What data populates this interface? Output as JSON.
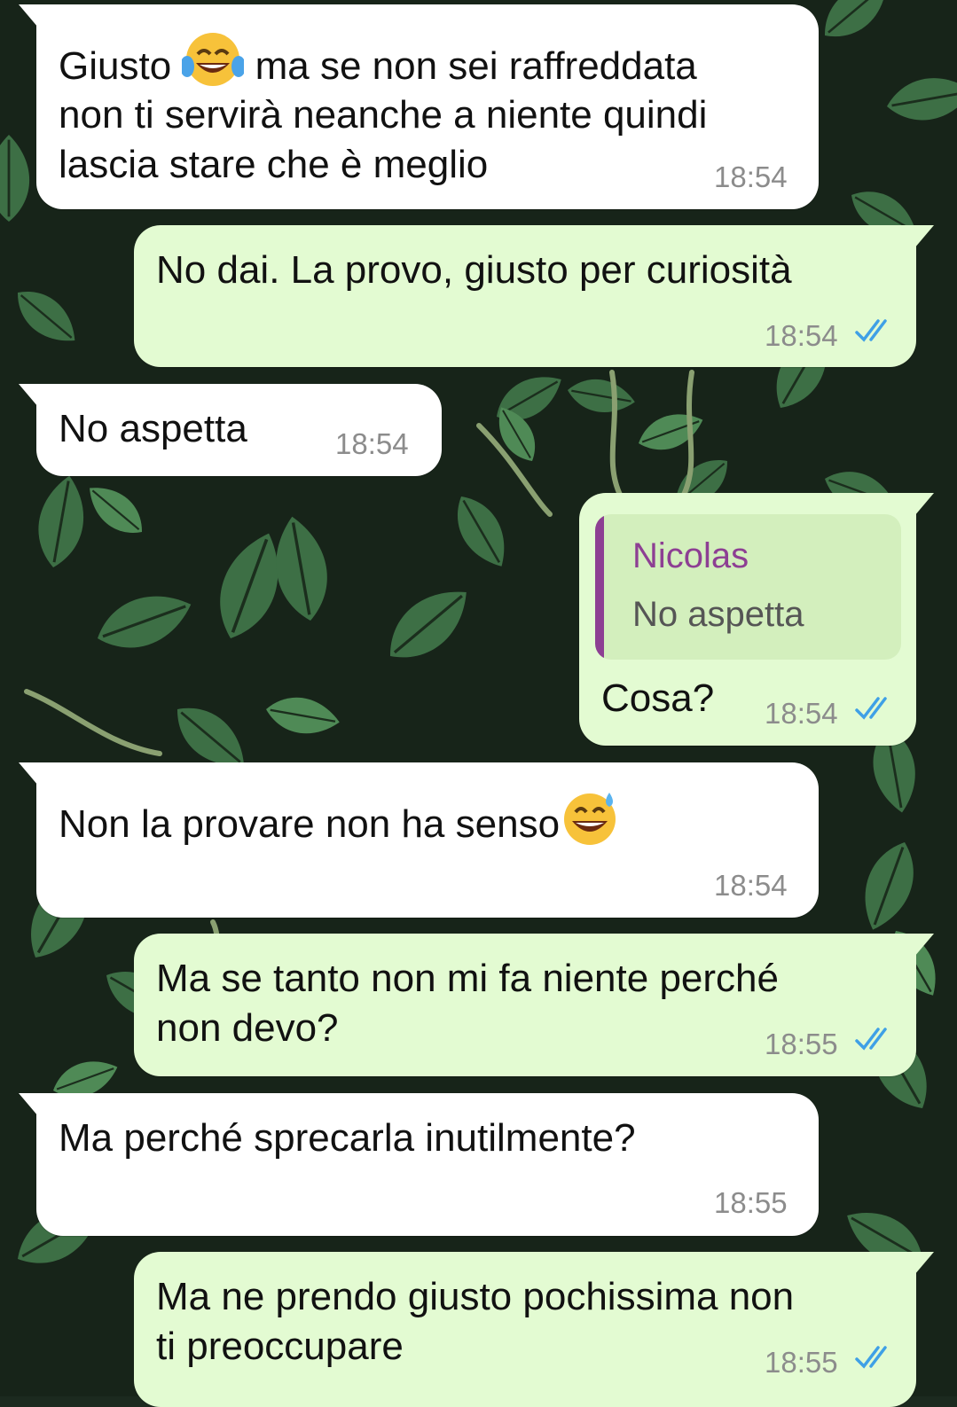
{
  "messages": [
    {
      "direction": "in",
      "text_before_emoji": "Giusto ",
      "emoji": "face-with-tears-of-joy",
      "text_after_emoji": " ma se non sei raffreddata",
      "line2": "non ti servirà neanche a niente quindi",
      "line3": "lascia stare che è meglio",
      "time": "18:54"
    },
    {
      "direction": "out",
      "text": "No dai. La provo, giusto per curiosità",
      "time": "18:54",
      "status": "read"
    },
    {
      "direction": "in",
      "text": "No aspetta",
      "time": "18:54"
    },
    {
      "direction": "out",
      "quoted": {
        "author": "Nicolas",
        "text": "No aspetta"
      },
      "text": "Cosa?",
      "time": "18:54",
      "status": "read"
    },
    {
      "direction": "in",
      "text": "Non la provare non ha senso",
      "emoji": "grinning-face-with-sweat",
      "time": "18:54"
    },
    {
      "direction": "out",
      "line1": "Ma se tanto non mi fa niente perché",
      "line2": "non devo?",
      "time": "18:55",
      "status": "read"
    },
    {
      "direction": "in",
      "text": "Ma perché sprecarla inutilmente?",
      "time": "18:55"
    },
    {
      "direction": "out",
      "line1": "Ma ne prendo giusto pochissima non",
      "line2": "ti preoccupare",
      "time": "18:55",
      "status": "read"
    }
  ],
  "colors": {
    "incoming_bubble": "#ffffff",
    "outgoing_bubble": "#e3fbd2",
    "read_ticks": "#3fa0e6",
    "quote_author": "#8d3f93",
    "timestamp": "#8c8c8c"
  }
}
